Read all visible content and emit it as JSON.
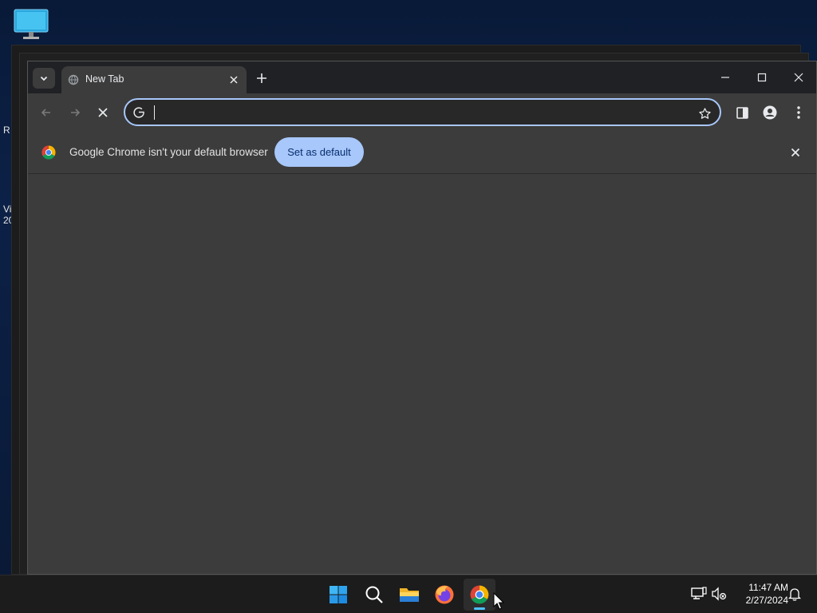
{
  "browser": {
    "tab": {
      "title": "New Tab"
    },
    "omnibox": {
      "value": "",
      "placeholder": ""
    },
    "infobar": {
      "message": "Google Chrome isn't your default browser",
      "button_label": "Set as default"
    }
  },
  "desktop": {
    "edge_text": [
      "R",
      "Vi",
      "20"
    ]
  },
  "taskbar": {
    "items": [
      "start-button",
      "search",
      "file-explorer",
      "firefox",
      "chrome"
    ],
    "clock": {
      "time": "11:47 AM",
      "date": "2/27/2024"
    }
  },
  "colors": {
    "accent": "#a8c7fa",
    "taskbar_indicator": "#4cc2ff",
    "chrome_frame": "#202124",
    "chrome_surface": "#3c3c3c"
  }
}
